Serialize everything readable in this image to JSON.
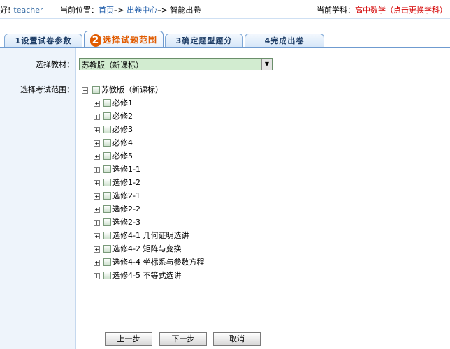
{
  "header": {
    "greeting": "好!",
    "user": "teacher",
    "location_label": "当前位置：",
    "crumb_home": "首页",
    "sep": "–",
    "arrow": ">",
    "crumb_center": "出卷中心",
    "crumb_current": "智能出卷",
    "subject_label": "当前学科：",
    "subject_value": "高中数学",
    "change_link": "（点击更换学科）"
  },
  "tabs": [
    {
      "label": "1设置试卷参数",
      "active": false
    },
    {
      "num": "2",
      "label": "选择试题范围",
      "active": true
    },
    {
      "label": "3确定题型题分",
      "active": false
    },
    {
      "label": "4完成出卷",
      "active": false
    }
  ],
  "form": {
    "textbook_label": "选择教材：",
    "textbook_value": "苏教版（新课标）",
    "range_label": "选择考试范围："
  },
  "tree": {
    "root": "苏教版（新课标）",
    "items": [
      "必修1",
      "必修2",
      "必修3",
      "必修4",
      "必修5",
      "选修1-1",
      "选修1-2",
      "选修2-1",
      "选修2-2",
      "选修2-3",
      "选修4-1 几何证明选讲",
      "选修4-2 矩阵与变换",
      "选修4-4 坐标系与参数方程",
      "选修4-5 不等式选讲"
    ]
  },
  "buttons": {
    "prev": "上一步",
    "next": "下一步",
    "cancel": "取消"
  },
  "colors": {
    "accent": "#e15b00",
    "tab_border": "#6f9bd0",
    "select_bg": "#d2ecd0",
    "link": "#1c5aa8"
  }
}
